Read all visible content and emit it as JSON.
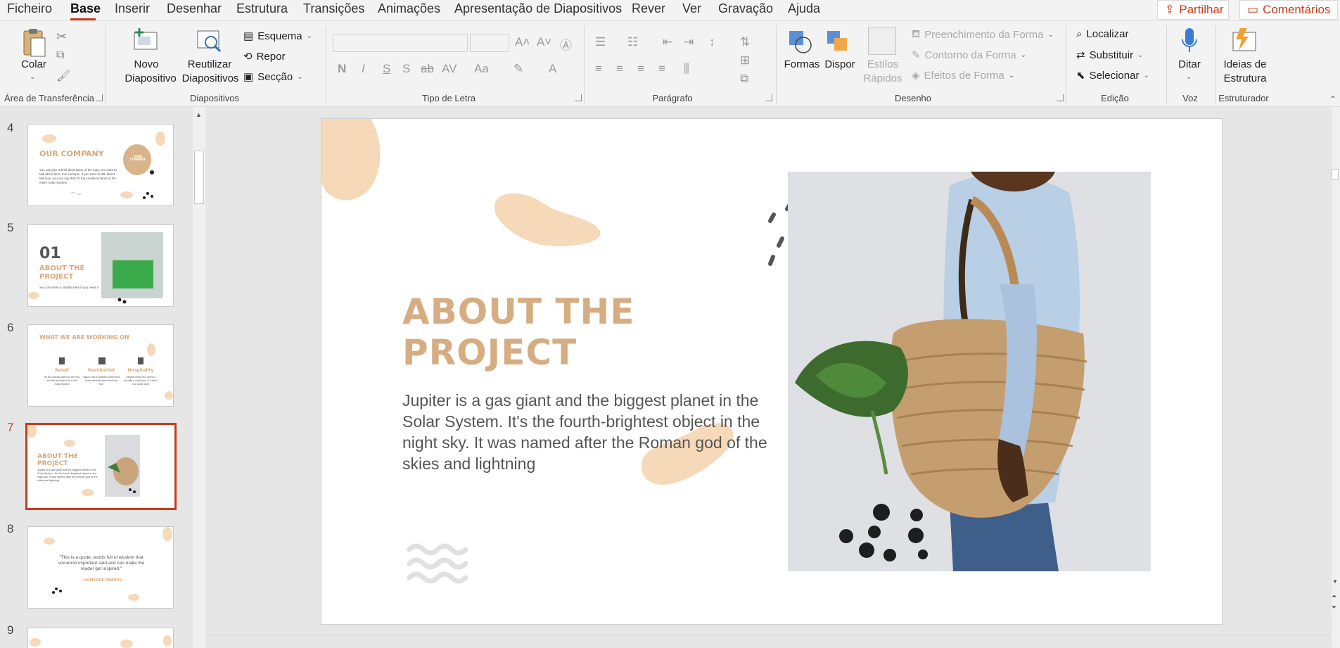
{
  "menu": {
    "tabs": [
      "Ficheiro",
      "Base",
      "Inserir",
      "Desenhar",
      "Estrutura",
      "Transições",
      "Animações",
      "Apresentação de Diapositivos",
      "Rever",
      "Ver",
      "Gravação",
      "Ajuda"
    ],
    "active_tab": "Base",
    "share_label": "Partilhar",
    "comments_label": "Comentários"
  },
  "ribbon": {
    "clipboard": {
      "paste_label": "Colar",
      "group_label": "Área de Transferência"
    },
    "slides": {
      "new_slide_line1": "Novo",
      "new_slide_line2": "Diapositivo",
      "reuse_line1": "Reutilizar",
      "reuse_line2": "Diapositivos",
      "layout_label": "Esquema",
      "reset_label": "Repor",
      "section_label": "Secção",
      "group_label": "Diapositivos"
    },
    "font": {
      "group_label": "Tipo de Letra",
      "font_name_value": "",
      "font_size_value": ""
    },
    "paragraph": {
      "group_label": "Parágrafo"
    },
    "drawing": {
      "shapes_label": "Formas",
      "arrange_label": "Dispor",
      "quick_styles_line1": "Estilos",
      "quick_styles_line2": "Rápidos",
      "shape_fill_label": "Preenchimento da Forma",
      "shape_outline_label": "Contorno da Forma",
      "shape_effects_label": "Efeitos de Forma",
      "group_label": "Desenho"
    },
    "editing": {
      "find_label": "Localizar",
      "replace_label": "Substituir",
      "select_label": "Selecionar",
      "group_label": "Edição"
    },
    "voice": {
      "dictate_label": "Ditar",
      "group_label": "Voz"
    },
    "designer": {
      "ideas_line1": "Ideias de",
      "ideas_line2": "Estrutura",
      "group_label": "Estruturador"
    }
  },
  "thumbnails": [
    {
      "number": "4",
      "title": "OUR COMPANY",
      "badge": "YOUR COMPANY",
      "body": "You can give a brief description of the topic you want to talk about here. For example, if you want to talk about Mercury, you can say that it's the smallest planet in the entire Solar System"
    },
    {
      "number": "5",
      "big_number": "01",
      "title": "ABOUT THE PROJECT",
      "body": "You can enter a subtitle here if you need it"
    },
    {
      "number": "6",
      "title": "WHAT WE ARE WORKING ON",
      "cols": [
        {
          "label": "Retail",
          "text": "It's the closest planet to the Sun and the smallest one in the Solar System"
        },
        {
          "label": "Residential",
          "text": "Saturn has a beautiful name and is the second planet from the Sun"
        },
        {
          "label": "Hospitality",
          "text": "Despite being red, Mars is actually a cold place. It's full of iron oxide dust"
        }
      ]
    },
    {
      "number": "7",
      "title": "ABOUT THE PROJECT",
      "body": "Jupiter is a gas giant and the biggest planet in the Solar System. It's the fourth-brightest object in the night sky. It was named after the Roman god of the skies and lightning"
    },
    {
      "number": "8",
      "quote": "\"This is a quote, words full of wisdom that someone important said and can make the reader get inspired.\"",
      "author": "—SOMEONE FAMOUS"
    },
    {
      "number": "9"
    }
  ],
  "selected_thumbnail": "7",
  "slide": {
    "title": "ABOUT THE\nPROJECT",
    "body": "Jupiter is a gas giant and the biggest planet in the Solar System. It's the fourth-brightest object in the night sky. It was named after the Roman god of the skies and lightning"
  },
  "colors": {
    "accent": "#c43e1c",
    "title_tan": "#d6ad82",
    "blob_peach": "#f5d9b8"
  }
}
